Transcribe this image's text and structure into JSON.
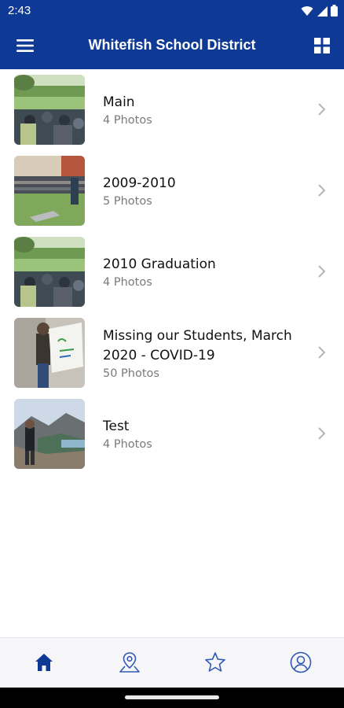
{
  "status_bar": {
    "time": "2:43"
  },
  "app_bar": {
    "title": "Whitefish School District"
  },
  "albums": [
    {
      "title": "Main",
      "count": "4 Photos"
    },
    {
      "title": "2009-2010",
      "count": "5 Photos"
    },
    {
      "title": "2010 Graduation",
      "count": "4 Photos"
    },
    {
      "title": "Missing our Students, March 2020 - COVID-19",
      "count": "50 Photos"
    },
    {
      "title": "Test",
      "count": "4 Photos"
    }
  ],
  "bottom_nav": {
    "items": [
      {
        "icon": "home-icon",
        "active": true
      },
      {
        "icon": "location-icon",
        "active": false
      },
      {
        "icon": "star-icon",
        "active": false
      },
      {
        "icon": "profile-icon",
        "active": false
      }
    ]
  },
  "colors": {
    "primary": "#0e3a96",
    "nav_active": "#0e3a96",
    "nav_inactive": "#2e58b8"
  }
}
